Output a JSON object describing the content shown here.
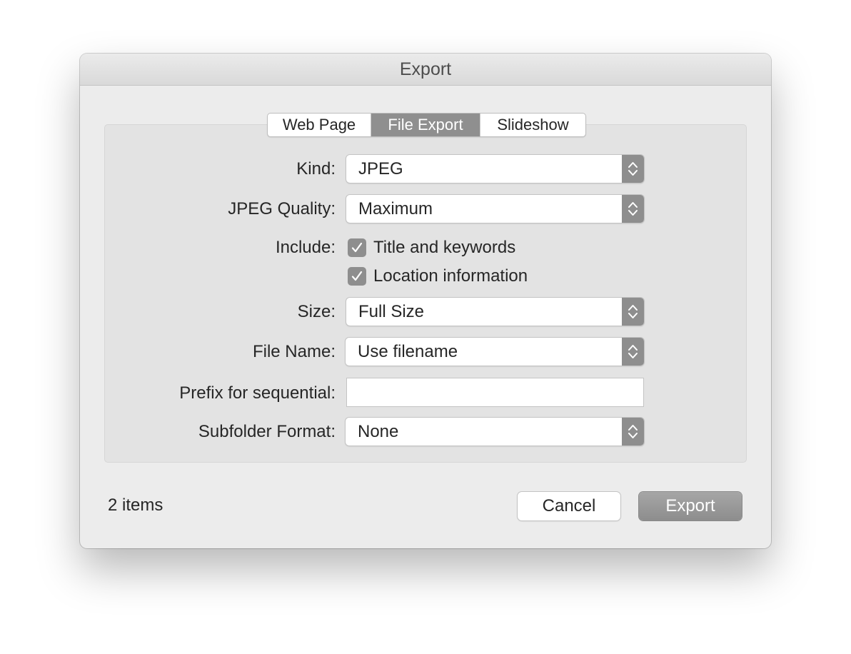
{
  "window": {
    "title": "Export"
  },
  "tabs": [
    {
      "label": "Web Page",
      "active": false
    },
    {
      "label": "File Export",
      "active": true
    },
    {
      "label": "Slideshow",
      "active": false
    }
  ],
  "form": {
    "kind": {
      "label": "Kind:",
      "value": "JPEG"
    },
    "jpeg_quality": {
      "label": "JPEG Quality:",
      "value": "Maximum"
    },
    "include": {
      "label": "Include:",
      "options": [
        {
          "label": "Title and keywords",
          "checked": true
        },
        {
          "label": "Location information",
          "checked": true
        }
      ]
    },
    "size": {
      "label": "Size:",
      "value": "Full Size"
    },
    "file_name": {
      "label": "File Name:",
      "value": "Use filename"
    },
    "prefix": {
      "label": "Prefix for sequential:",
      "value": "",
      "placeholder": ""
    },
    "subfolder_format": {
      "label": "Subfolder Format:",
      "value": "None"
    }
  },
  "footer": {
    "items_count": "2 items",
    "cancel_label": "Cancel",
    "export_label": "Export"
  },
  "icons": {
    "popup_arrows": "up-down-chevron-icon",
    "checkbox_mark": "checkmark-icon"
  },
  "colors": {
    "selected_tab": "#8f8f8f",
    "control_accent": "#8e8e8e",
    "window_bg": "#ececec",
    "panel_bg": "#e3e3e3"
  }
}
